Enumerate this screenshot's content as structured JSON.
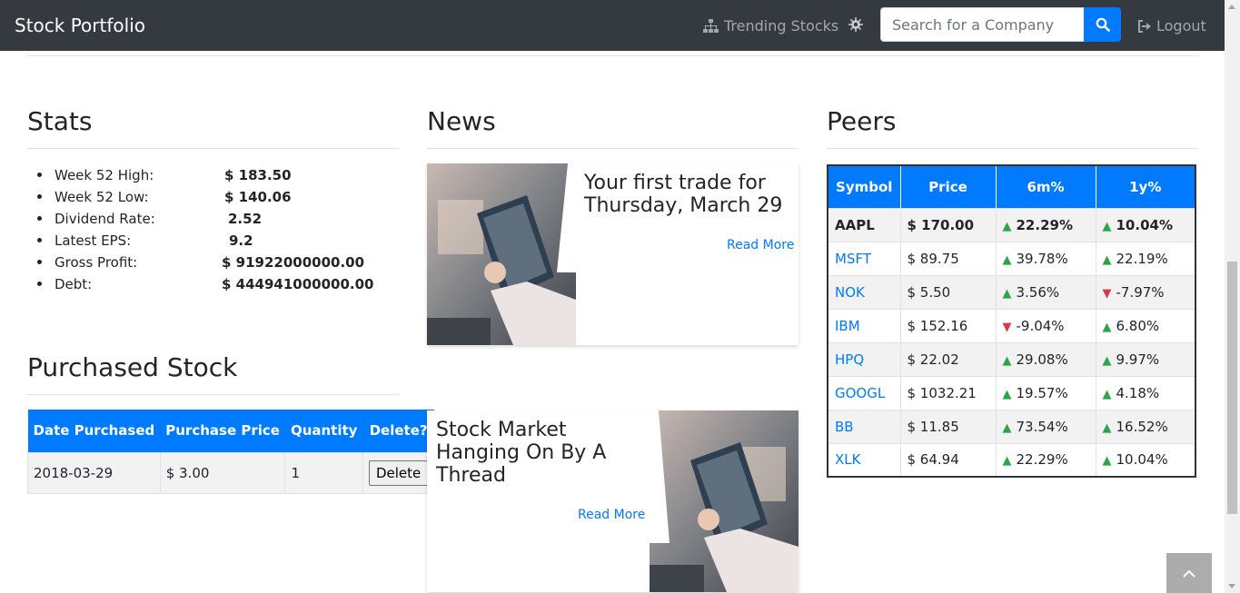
{
  "nav": {
    "brand": "Stock Portfolio",
    "trending": "Trending Stocks",
    "search_placeholder": "Search for a Company",
    "logout": "Logout"
  },
  "stats": {
    "title": "Stats",
    "items": [
      {
        "label": "Week 52 High:",
        "value": "$ 183.50"
      },
      {
        "label": "Week 52 Low:",
        "value": "$ 140.06"
      },
      {
        "label": "Dividend Rate:",
        "value": "2.52"
      },
      {
        "label": "Latest EPS:",
        "value": "9.2"
      },
      {
        "label": "Gross Profit:",
        "value": "$ 91922000000.00"
      },
      {
        "label": "Debt:",
        "value": "$ 444941000000.00"
      }
    ]
  },
  "purchased": {
    "title": "Purchased Stock",
    "headers": [
      "Date Purchased",
      "Purchase Price",
      "Quantity",
      "Delete?"
    ],
    "rows": [
      {
        "date": "2018-03-29",
        "price": "$ 3.00",
        "quantity": "1",
        "delete_label": "Delete"
      }
    ]
  },
  "news": {
    "title": "News",
    "articles": [
      {
        "headline": "Your first trade for Thursday, March 29",
        "link": "Read More"
      },
      {
        "headline": "Stock Market Hanging On By A Thread",
        "link": "Read More"
      }
    ]
  },
  "peers": {
    "title": "Peers",
    "headers": [
      "Symbol",
      "Price",
      "6m%",
      "1y%"
    ],
    "rows": [
      {
        "symbol": "AAPL",
        "price": "$ 170.00",
        "m6": "22.29%",
        "m6_dir": "up",
        "y1": "10.04%",
        "y1_dir": "up"
      },
      {
        "symbol": "MSFT",
        "price": "$ 89.75",
        "m6": "39.78%",
        "m6_dir": "up",
        "y1": "22.19%",
        "y1_dir": "up"
      },
      {
        "symbol": "NOK",
        "price": "$ 5.50",
        "m6": "3.56%",
        "m6_dir": "up",
        "y1": "-7.97%",
        "y1_dir": "down"
      },
      {
        "symbol": "IBM",
        "price": "$ 152.16",
        "m6": "-9.04%",
        "m6_dir": "down",
        "y1": "6.80%",
        "y1_dir": "up"
      },
      {
        "symbol": "HPQ",
        "price": "$ 22.02",
        "m6": "29.08%",
        "m6_dir": "up",
        "y1": "9.97%",
        "y1_dir": "up"
      },
      {
        "symbol": "GOOGL",
        "price": "$ 1032.21",
        "m6": "19.57%",
        "m6_dir": "up",
        "y1": "4.18%",
        "y1_dir": "up"
      },
      {
        "symbol": "BB",
        "price": "$ 11.85",
        "m6": "73.54%",
        "m6_dir": "up",
        "y1": "16.52%",
        "y1_dir": "up"
      },
      {
        "symbol": "XLK",
        "price": "$ 64.94",
        "m6": "22.29%",
        "m6_dir": "up",
        "y1": "10.04%",
        "y1_dir": "up"
      }
    ]
  },
  "colors": {
    "navbar": "#343a40",
    "accent": "#007bff",
    "up": "#28a745",
    "down": "#dc3545"
  }
}
